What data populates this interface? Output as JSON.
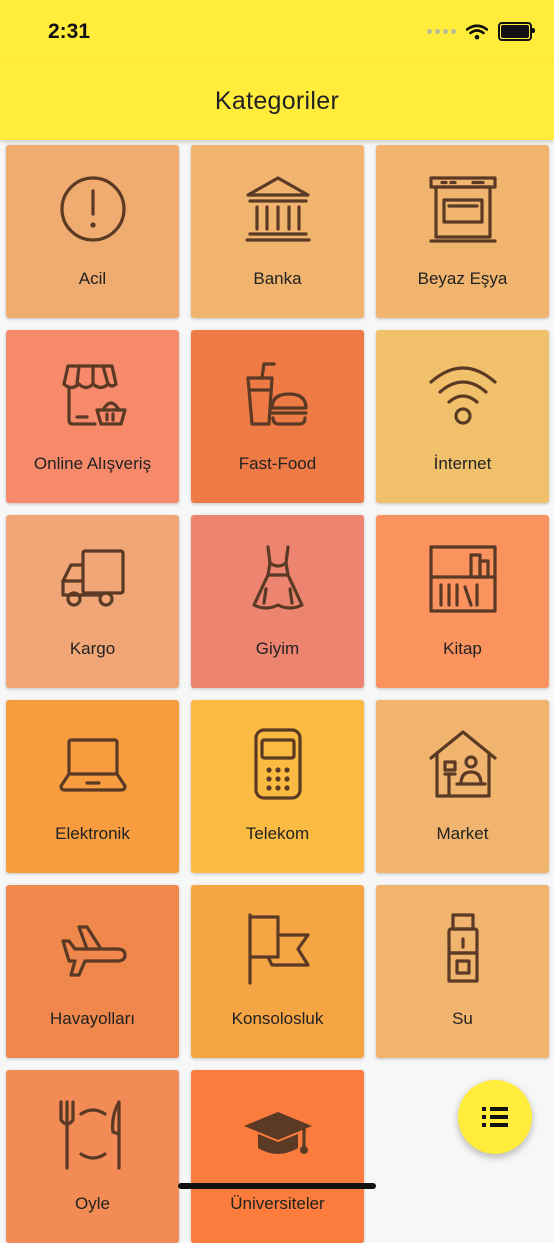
{
  "status_bar": {
    "time": "2:31"
  },
  "app_bar": {
    "title": "Kategoriler"
  },
  "categories": [
    {
      "label": "Acil",
      "icon": "alert-icon",
      "color": "#f0ab70"
    },
    {
      "label": "Banka",
      "icon": "bank-icon",
      "color": "#f1b46e"
    },
    {
      "label": "Beyaz Eşya",
      "icon": "oven-icon",
      "color": "#f1b46e"
    },
    {
      "label": "Online Alışveriş",
      "icon": "online-shopping-icon",
      "color": "#f68a6b"
    },
    {
      "label": "Fast-Food",
      "icon": "fast-food-icon",
      "color": "#ee7b46"
    },
    {
      "label": "İnternet",
      "icon": "wifi-icon",
      "color": "#f0c06a"
    },
    {
      "label": "Kargo",
      "icon": "truck-icon",
      "color": "#f0a676"
    },
    {
      "label": "Giyim",
      "icon": "dress-icon",
      "color": "#ec8470"
    },
    {
      "label": "Kitap",
      "icon": "bookshelf-icon",
      "color": "#fb935e"
    },
    {
      "label": "Elektronik",
      "icon": "laptop-icon",
      "color": "#f79d40"
    },
    {
      "label": "Telekom",
      "icon": "phone-icon",
      "color": "#fbbb42"
    },
    {
      "label": "Market",
      "icon": "market-icon",
      "color": "#f1b46e"
    },
    {
      "label": "Havayolları",
      "icon": "airplane-icon",
      "color": "#f0874c"
    },
    {
      "label": "Konsolosluk",
      "icon": "flag-icon",
      "color": "#f6a544"
    },
    {
      "label": "Su",
      "icon": "water-dispenser-icon",
      "color": "#f1b46e"
    },
    {
      "label": "Oyle",
      "icon": "dining-icon",
      "color": "#f28b56"
    },
    {
      "label": "Üniversiteler",
      "icon": "graduation-cap-icon",
      "color": "#fb7c3c"
    }
  ],
  "fab": {
    "icon": "list-icon"
  }
}
